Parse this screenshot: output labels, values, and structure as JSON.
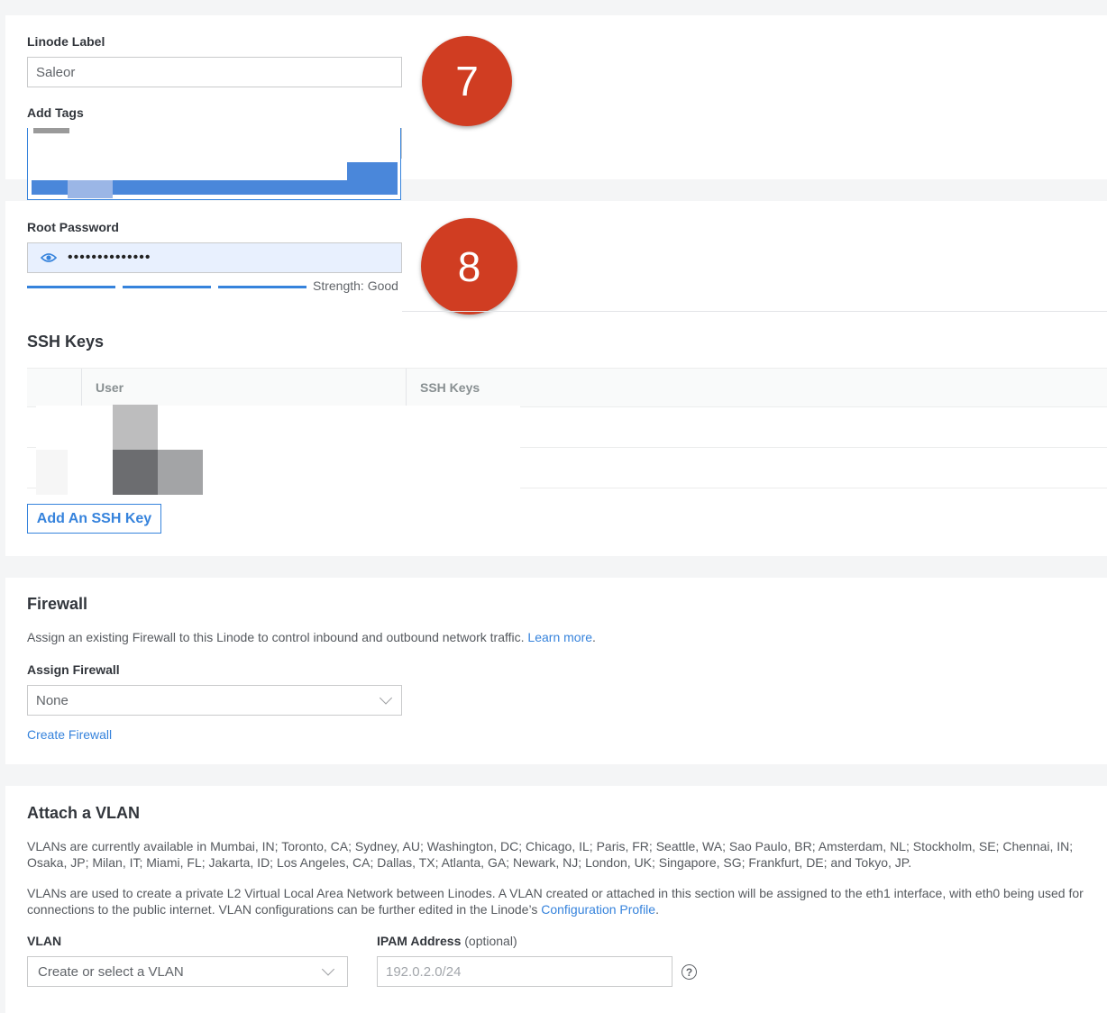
{
  "details": {
    "label_title": "Linode Label",
    "label_value": "Saleor",
    "tags_title": "Add Tags"
  },
  "badges": {
    "first": "7",
    "second": "8"
  },
  "password": {
    "title": "Root Password",
    "masked_value": "••••••••••••••",
    "strength_text": "Strength: Good"
  },
  "ssh": {
    "title": "SSH Keys",
    "columns": [
      "User",
      "SSH Keys"
    ],
    "add_button": "Add An SSH Key"
  },
  "firewall": {
    "title": "Firewall",
    "description": "Assign an existing Firewall to this Linode to control inbound and outbound network traffic.",
    "learn_more": "Learn more",
    "assign_label": "Assign Firewall",
    "selected": "None",
    "create_link": "Create Firewall"
  },
  "vlan": {
    "title": "Attach a VLAN",
    "availability": "VLANs are currently available in Mumbai, IN; Toronto, CA; Sydney, AU; Washington, DC; Chicago, IL; Paris, FR; Seattle, WA; Sao Paulo, BR; Amsterdam, NL; Stockholm, SE; Chennai, IN; Osaka, JP; Milan, IT; Miami, FL; Jakarta, ID; Los Angeles, CA; Dallas, TX; Atlanta, GA; Newark, NJ; London, UK; Singapore, SG; Frankfurt, DE; and Tokyo, JP.",
    "description": "VLANs are used to create a private L2 Virtual Local Area Network between Linodes. A VLAN created or attached in this section will be assigned to the eth1 interface, with eth0 being used for connections to the public internet. VLAN configurations can be further edited in the Linode’s",
    "config_link": "Configuration Profile",
    "vlan_label": "VLAN",
    "vlan_placeholder": "Create or select a VLAN",
    "ipam_label": "IPAM Address",
    "ipam_optional": "(optional)",
    "ipam_placeholder": "192.0.2.0/24"
  },
  "colors": {
    "accent": "#3683dc",
    "badge": "#d03d22"
  }
}
